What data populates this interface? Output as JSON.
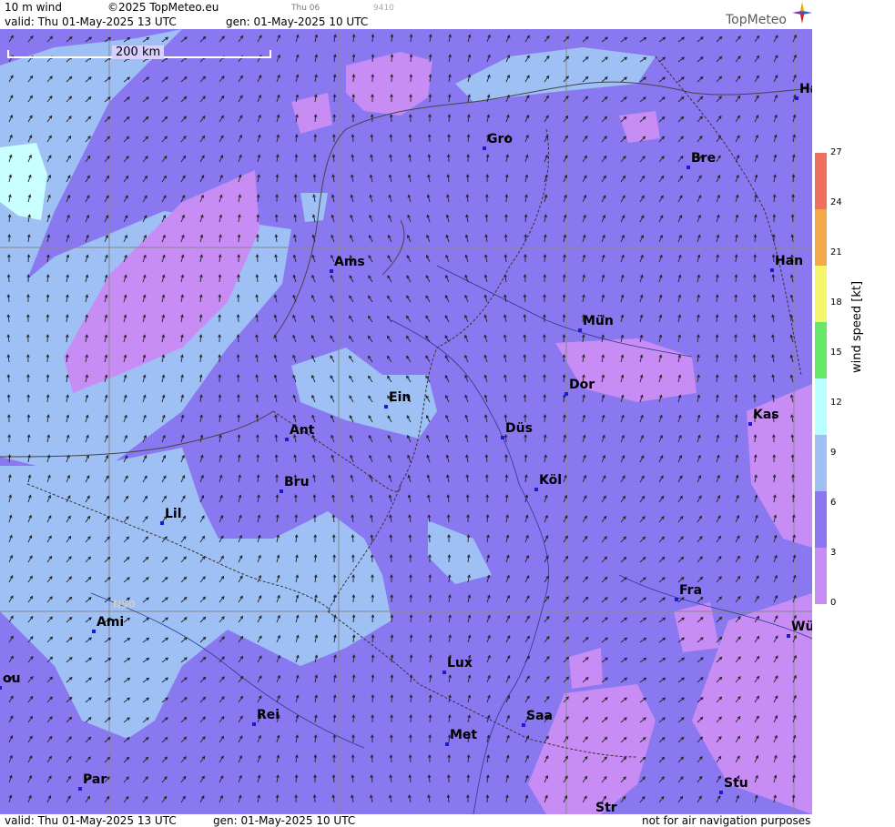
{
  "header": {
    "title": "10 m wind",
    "copyright": "©2025 TopMeteo.eu",
    "small_label": "Thu 06",
    "small_code": "9410",
    "valid": "valid:  Thu  01-May-2025  13 UTC",
    "gen": "gen: 01-May-2025 10 UTC",
    "logo": "TopMeteo"
  },
  "footer": {
    "valid": "valid:  Thu  01-May-2025  13 UTC",
    "gen": "gen: 01-May-2025 10 UTC",
    "disclaimer": "not for air navigation purposes"
  },
  "scale": {
    "label": "200 km"
  },
  "grid_label": "N50",
  "cities": [
    "Ha",
    "Gro",
    "Bre",
    "Ams",
    "Han",
    "Mün",
    "Ein",
    "Dor",
    "Kas",
    "Ant",
    "Düs",
    "Bru",
    "Köl",
    "Lil",
    "Fra",
    "Ami",
    "Wü",
    "ou",
    "Lux",
    "Rei",
    "Saa",
    "Met",
    "Par",
    "Stu",
    "Str"
  ],
  "legend": {
    "label": "wind  speed  [kt]",
    "ticks": [
      "27",
      "24",
      "21",
      "18",
      "15",
      "12",
      "9",
      "6",
      "3",
      "0"
    ],
    "colors": [
      "#c88cf5",
      "#8a78f0",
      "#9ec0f5",
      "#b8ffff",
      "#68e868",
      "#f5f56a",
      "#f5a848",
      "#f07060"
    ]
  }
}
